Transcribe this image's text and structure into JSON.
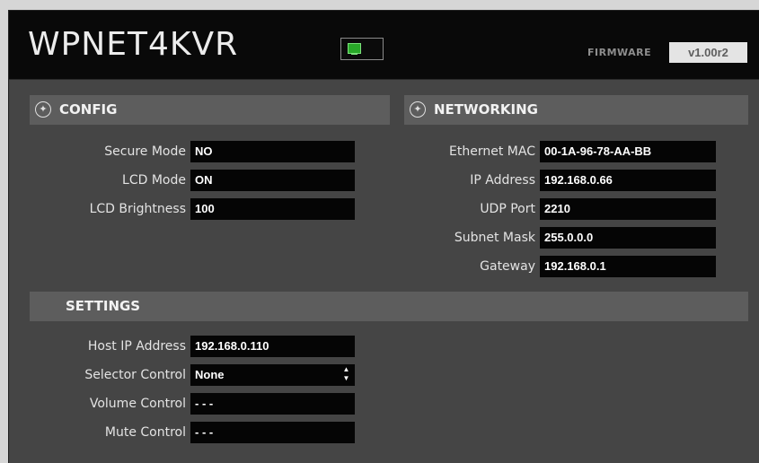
{
  "header": {
    "title": "WPNET4KVR",
    "network_icon": "monitor-icon",
    "firmware_label": "FIRMWARE",
    "firmware_version": "v1.00r2"
  },
  "config": {
    "title": "CONFIG",
    "icon": "wrench-icon",
    "rows": [
      {
        "label": "Secure Mode",
        "value": "NO"
      },
      {
        "label": "LCD Mode",
        "value": "ON"
      },
      {
        "label": "LCD Brightness",
        "value": "100"
      }
    ]
  },
  "networking": {
    "title": "NETWORKING",
    "icon": "wrench-icon",
    "rows": [
      {
        "label": "Ethernet MAC",
        "value": "00-1A-96-78-AA-BB"
      },
      {
        "label": "IP Address",
        "value": "192.168.0.66"
      },
      {
        "label": "UDP Port",
        "value": "2210"
      },
      {
        "label": "Subnet Mask",
        "value": "255.0.0.0"
      },
      {
        "label": "Gateway",
        "value": "192.168.0.1"
      }
    ]
  },
  "settings": {
    "title": "SETTINGS",
    "rows": [
      {
        "label": "Host IP Address",
        "value": "192.168.0.110"
      },
      {
        "label": "Selector Control",
        "value": "None"
      },
      {
        "label": "Volume Control",
        "value": "- - -"
      },
      {
        "label": "Mute Control",
        "value": "- - -"
      }
    ]
  },
  "colors": {
    "background": "#454545",
    "header": "#090909",
    "section_header": "#5d5d5d",
    "field": "#050505",
    "indicator": "#28a828"
  }
}
